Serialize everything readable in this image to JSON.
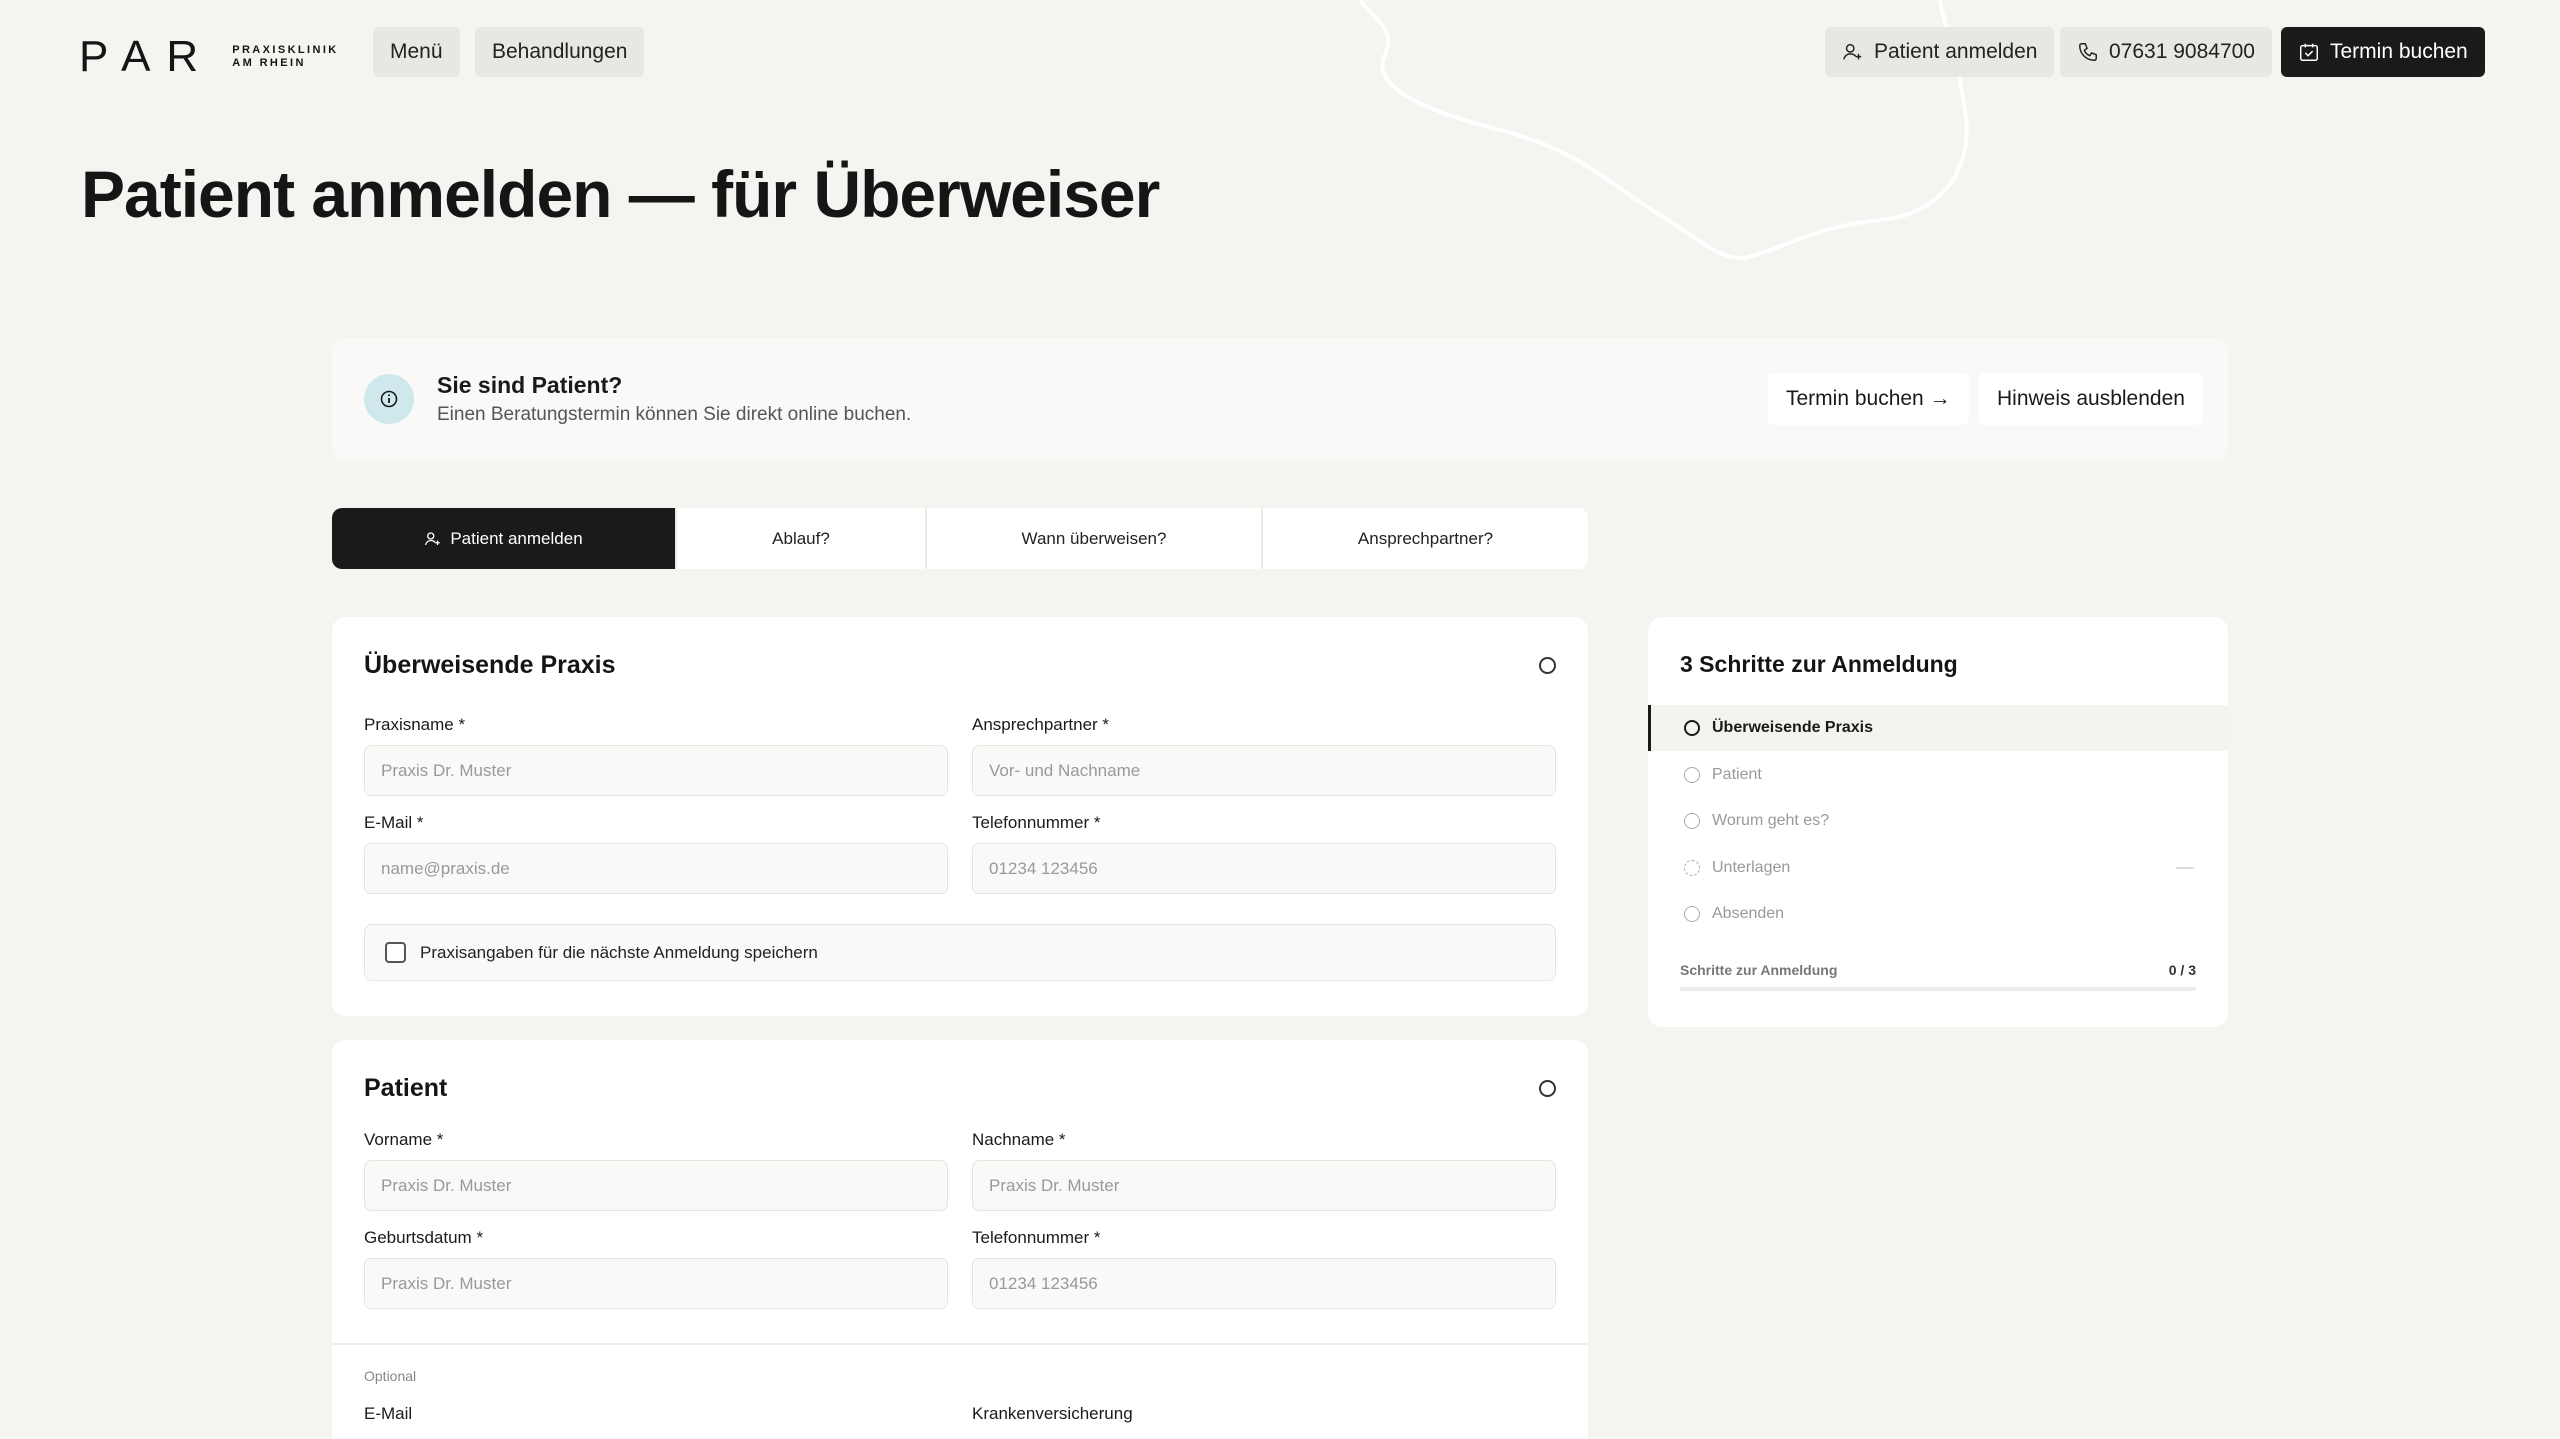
{
  "header": {
    "logo_mark": "PAR",
    "logo_sub_line1": "PRAXISKLINIK",
    "logo_sub_line2": "AM RHEIN",
    "menu_label": "Menü",
    "treatments_label": "Behandlungen",
    "register_patient_label": "Patient anmelden",
    "phone_label": "07631 9084700",
    "book_label": "Termin buchen"
  },
  "page": {
    "title": "Patient anmelden — für Überweiser"
  },
  "banner": {
    "title": "Sie sind Patient?",
    "subtitle": "Einen Beratungstermin können Sie direkt online buchen.",
    "book_label": "Termin buchen →",
    "hide_label": "Hinweis ausblenden"
  },
  "tabs": [
    {
      "label": "Patient anmelden",
      "active": true
    },
    {
      "label": "Ablauf?",
      "active": false
    },
    {
      "label": "Wann überweisen?",
      "active": false
    },
    {
      "label": "Ansprechpartner?",
      "active": false
    }
  ],
  "practice_card": {
    "title": "Überweisende Praxis",
    "fields": {
      "practice_name": {
        "label": "Praxisname *",
        "placeholder": "Praxis Dr. Muster"
      },
      "contact_person": {
        "label": "Ansprechpartner *",
        "placeholder": "Vor- und Nachname"
      },
      "email": {
        "label": "E-Mail *",
        "placeholder": "name@praxis.de"
      },
      "phone": {
        "label": "Telefonnummer *",
        "placeholder": "01234 123456"
      }
    },
    "save_checkbox_label": "Praxisangaben für die nächste Anmeldung speichern"
  },
  "patient_card": {
    "title": "Patient",
    "fields": {
      "first_name": {
        "label": "Vorname *",
        "placeholder": "Praxis Dr. Muster"
      },
      "last_name": {
        "label": "Nachname *",
        "placeholder": "Praxis Dr. Muster"
      },
      "birth_date": {
        "label": "Geburtsdatum *",
        "placeholder": "Praxis Dr. Muster"
      },
      "phone": {
        "label": "Telefonnummer *",
        "placeholder": "01234 123456"
      }
    },
    "optional_label": "Optional",
    "optional_fields": {
      "email": {
        "label": "E-Mail"
      },
      "insurance": {
        "label": "Krankenversicherung"
      }
    }
  },
  "steps_card": {
    "title": "3 Schritte zur Anmeldung",
    "steps": [
      {
        "label": "Überweisende Praxis",
        "active": true
      },
      {
        "label": "Patient",
        "active": false
      },
      {
        "label": "Worum geht es?",
        "active": false
      },
      {
        "label": "Unterlagen",
        "active": false
      },
      {
        "label": "Absenden",
        "active": false
      }
    ],
    "progress_label": "Schritte zur Anmeldung",
    "progress_count": "0 / 3",
    "progress_fraction": 0
  }
}
